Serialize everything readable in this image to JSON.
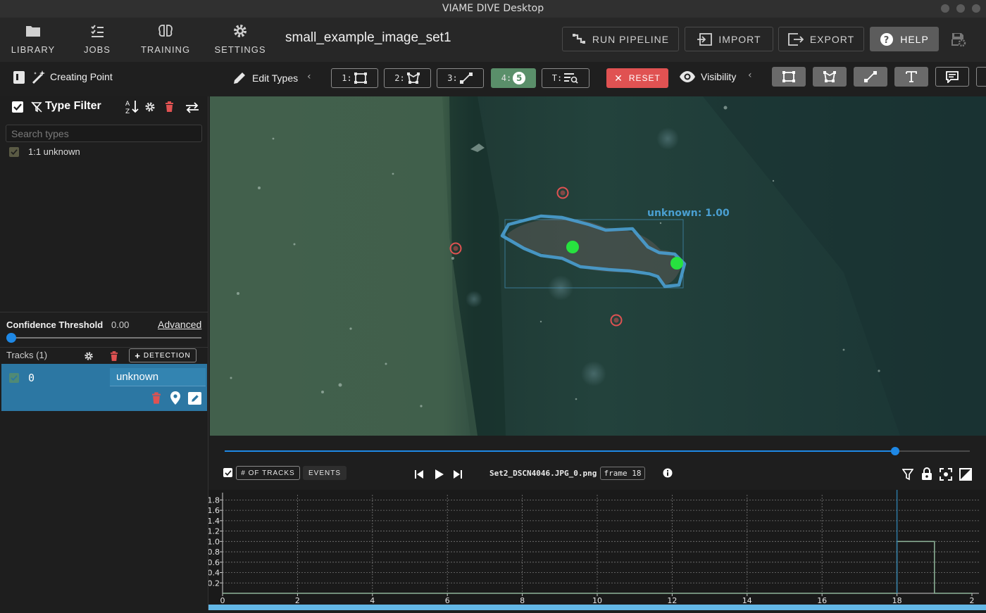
{
  "window": {
    "title": "VIAME DIVE Desktop"
  },
  "nav": {
    "library": "LIBRARY",
    "jobs": "JOBS",
    "training": "TRAINING",
    "settings": "SETTINGS"
  },
  "dataset": {
    "name": "small_example_image_set1"
  },
  "top_actions": {
    "run_pipeline": "RUN PIPELINE",
    "import": "IMPORT",
    "export": "EXPORT",
    "help": "HELP"
  },
  "toolbar": {
    "mode_status": "Creating Point",
    "edit_types": "Edit Types",
    "mode_buttons": [
      {
        "key": "1:",
        "icon": "rectangle-icon"
      },
      {
        "key": "2:",
        "icon": "polygon-icon"
      },
      {
        "key": "3:",
        "icon": "line-icon"
      },
      {
        "key": "4:",
        "badge": "5",
        "icon": "point-count-icon"
      },
      {
        "key": "T:",
        "icon": "text-search-icon"
      }
    ],
    "reset": "RESET",
    "visibility": "Visibility"
  },
  "type_filter": {
    "title": "Type Filter",
    "search_placeholder": "Search types",
    "types": [
      {
        "label": "1:1 unknown",
        "checked": true
      }
    ]
  },
  "confidence": {
    "label": "Confidence Threshold",
    "value": "0.00",
    "advanced": "Advanced",
    "slider_fraction": 0.0
  },
  "tracks": {
    "header": "Tracks (1)",
    "add_detection": "DETECTION",
    "items": [
      {
        "id": "0",
        "type": "unknown",
        "checked": true
      }
    ]
  },
  "annotation": {
    "label": "unknown: 1.00",
    "color": "#4a9fd1",
    "head_point_color": "#27e23f",
    "candidate_point_color": "#e05252"
  },
  "timeline": {
    "progress_fraction": 0.9,
    "num_tracks_btn": "# OF TRACKS",
    "events_btn": "EVENTS",
    "filename": "Set2_DSCN4046.JPG_0.png",
    "frame_label": "frame 18"
  },
  "chart_data": {
    "type": "line",
    "x_ticks": [
      0,
      2,
      4,
      6,
      8,
      10,
      12,
      14,
      16,
      18,
      2
    ],
    "y_ticks": [
      0.2,
      0.4,
      0.6,
      0.8,
      1.0,
      1.2,
      1.4,
      1.6,
      1.8
    ],
    "xlim": [
      0,
      20
    ],
    "ylim": [
      0,
      1.9
    ],
    "series": [
      {
        "x": [
          0,
          18,
          18,
          19,
          19,
          20
        ],
        "y": [
          0,
          0,
          1,
          1,
          0,
          0
        ]
      }
    ],
    "current_frame": 18,
    "grid": true
  },
  "colors": {
    "accent": "#1e88e5",
    "reset_red": "#e05252",
    "track_row_bg": "#2c77a3",
    "delete_red": "#e05252"
  }
}
